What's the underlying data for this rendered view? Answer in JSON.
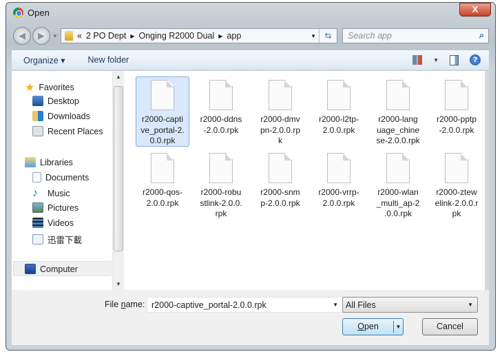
{
  "window": {
    "title": "Open",
    "close_label": "X"
  },
  "address": {
    "overflow": "«",
    "crumbs": [
      "2 PO Dept",
      "Onging R2000 Dual",
      "app"
    ]
  },
  "search": {
    "placeholder": "Search app"
  },
  "toolbar": {
    "organize": "Organize ▾",
    "new_folder": "New folder"
  },
  "nav": {
    "favorites": "Favorites",
    "desktop": "Desktop",
    "downloads": "Downloads",
    "recent": "Recent Places",
    "libraries": "Libraries",
    "documents": "Documents",
    "music": "Music",
    "pictures": "Pictures",
    "videos": "Videos",
    "xunlei": "迅雷下載",
    "computer": "Computer"
  },
  "files": [
    {
      "lines": [
        "r2000-capti",
        "ve_portal-2.",
        "0.0.rpk"
      ],
      "selected": true
    },
    {
      "lines": [
        "r2000-ddns",
        "-2.0.0.rpk"
      ]
    },
    {
      "lines": [
        "r2000-dmv",
        "pn-2.0.0.rp",
        "k"
      ]
    },
    {
      "lines": [
        "r2000-l2tp-",
        "2.0.0.rpk"
      ]
    },
    {
      "lines": [
        "r2000-lang",
        "uage_chine",
        "se-2.0.0.rpk"
      ]
    },
    {
      "lines": [
        "r2000-pptp",
        "-2.0.0.rpk"
      ]
    },
    {
      "lines": [
        "r2000-qos-",
        "2.0.0.rpk"
      ]
    },
    {
      "lines": [
        "r2000-robu",
        "stlink-2.0.0.",
        "rpk"
      ]
    },
    {
      "lines": [
        "r2000-snm",
        "p-2.0.0.rpk"
      ]
    },
    {
      "lines": [
        "r2000-vrrp-",
        "2.0.0.rpk"
      ]
    },
    {
      "lines": [
        "r2000-wlan",
        "_multi_ap-2",
        ".0.0.rpk"
      ]
    },
    {
      "lines": [
        "r2000-ztew",
        "elink-2.0.0.r",
        "pk"
      ]
    }
  ],
  "bottom": {
    "file_name_label_pre": "File ",
    "file_name_label_key": "n",
    "file_name_label_post": "ame:",
    "file_name_value": "r2000-captive_portal-2.0.0.rpk",
    "filter_value": "All Files",
    "open_key": "O",
    "open_rest": "pen",
    "cancel": "Cancel"
  }
}
